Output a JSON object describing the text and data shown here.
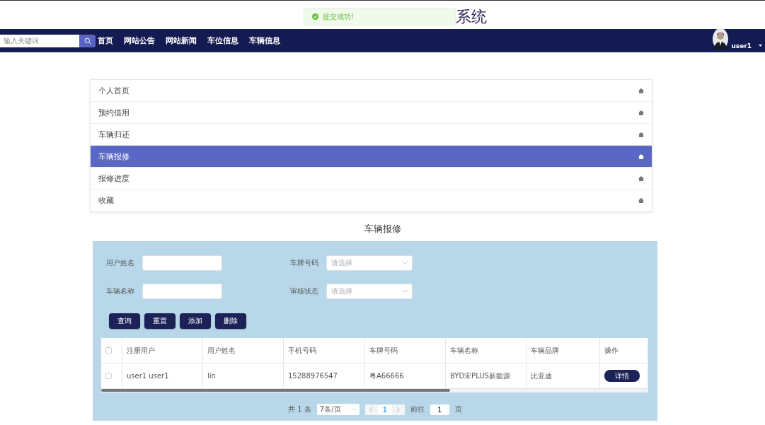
{
  "header": {
    "title": "系统"
  },
  "toast": {
    "message": "提交成功!"
  },
  "navbar": {
    "search": {
      "placeholder": "输入关键词"
    },
    "links": [
      "首页",
      "网站公告",
      "网站新闻",
      "车位信息",
      "车辆信息"
    ],
    "user": {
      "name": "user1"
    }
  },
  "menu": [
    {
      "label": "个人首页",
      "selected": false
    },
    {
      "label": "预约借用",
      "selected": false
    },
    {
      "label": "车辆归还",
      "selected": false
    },
    {
      "label": "车辆报修",
      "selected": true
    },
    {
      "label": "报修进度",
      "selected": false
    },
    {
      "label": "收藏",
      "selected": false
    }
  ],
  "section_title": "车辆报修",
  "filters": [
    {
      "kind": "text",
      "label": "用户姓名"
    },
    {
      "kind": "select",
      "label": "车牌号码",
      "placeholder": "请选择"
    },
    {
      "kind": "text",
      "label": "车辆名称"
    },
    {
      "kind": "select",
      "label": "审核状态",
      "placeholder": "请选择"
    }
  ],
  "actions": [
    "查询",
    "重置",
    "添加",
    "删除"
  ],
  "table": {
    "select_all": false,
    "columns": [
      "注册用户",
      "用户姓名",
      "手机号码",
      "车牌号码",
      "车辆名称",
      "车辆品牌",
      "操作"
    ],
    "rows": [
      {
        "checked": false,
        "cells": [
          "user1 user1",
          "lin",
          "15288976547",
          "粤A66666",
          "BYD宋PLUS新能源",
          "比亚迪"
        ],
        "action": "详情"
      }
    ]
  },
  "pagination": {
    "total": "共 1 条",
    "page_size": "7条/页",
    "current": "1",
    "goto_label": "前往",
    "goto_value": "1",
    "goto_suffix": "页"
  }
}
